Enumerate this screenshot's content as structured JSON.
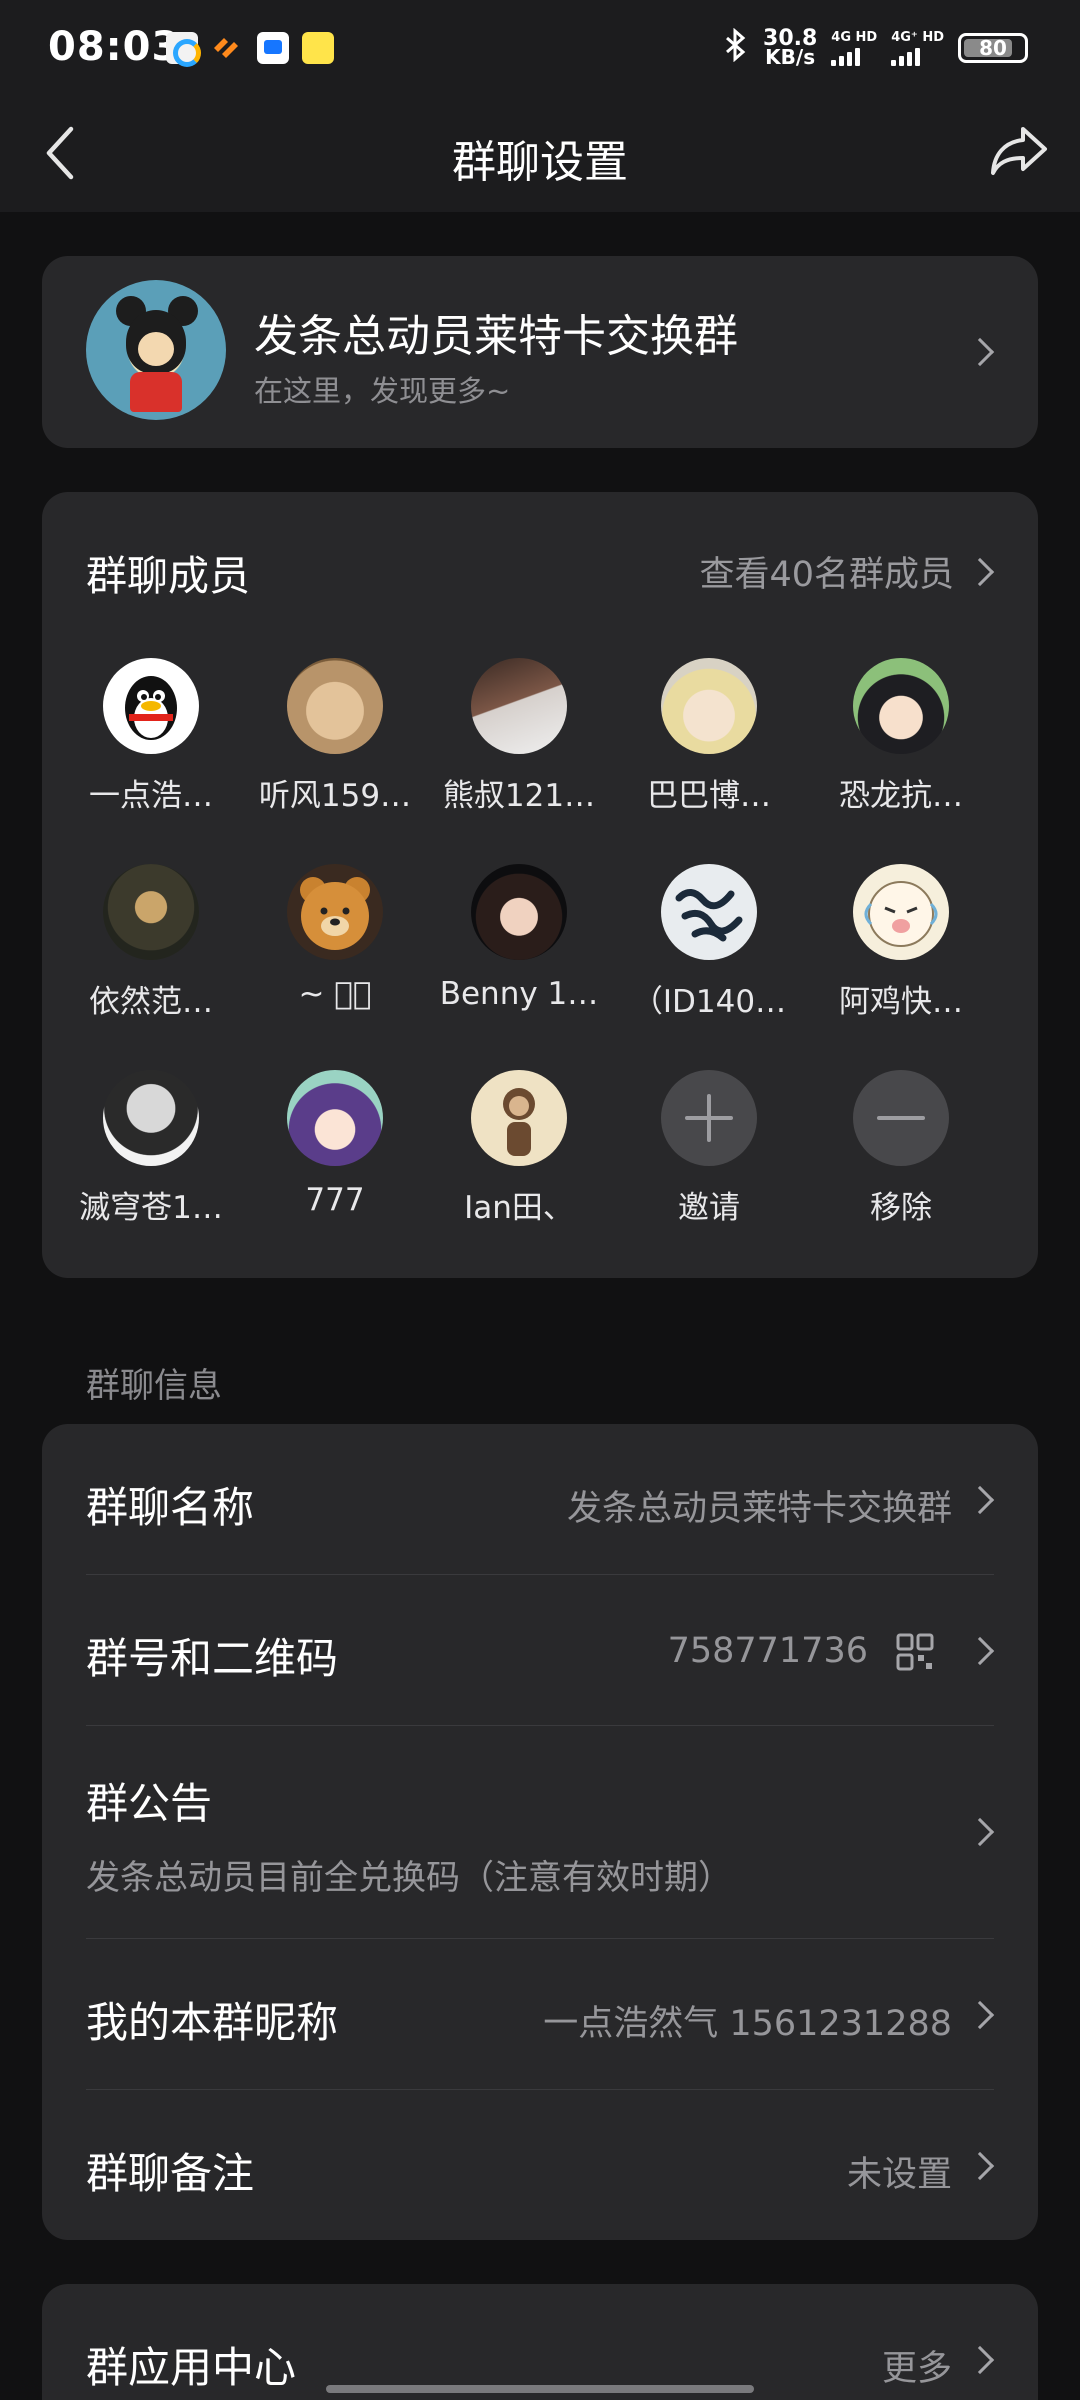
{
  "status_bar": {
    "time": "08:03",
    "speed_value": "30.8",
    "speed_unit": "KB/s",
    "sim1": "4G HD",
    "sim2": "4G⁺ HD",
    "battery": "80"
  },
  "header": {
    "title": "群聊设置"
  },
  "group": {
    "name": "发条总动员莱特卡交换群",
    "subtitle": "在这里，发现更多~"
  },
  "members": {
    "title": "群聊成员",
    "view_all": "查看40名群成员",
    "items": [
      {
        "name": "一点浩…",
        "avatar": "penguin-avatar"
      },
      {
        "name": "听风159…",
        "avatar": "dog-avatar"
      },
      {
        "name": "熊叔121…",
        "avatar": "man-avatar"
      },
      {
        "name": "巴巴博…",
        "avatar": "anime-avatar"
      },
      {
        "name": "恐龙抗…",
        "avatar": "anime-boy-avatar"
      },
      {
        "name": "依然范…",
        "avatar": "person-avatar"
      },
      {
        "name": "~ ෆ゙",
        "avatar": "teddy-bear-avatar"
      },
      {
        "name": "Benny 1…",
        "avatar": "person-avatar"
      },
      {
        "name": "（ID140…",
        "avatar": "calligraphy-avatar"
      },
      {
        "name": "阿鸡快…",
        "avatar": "cartoon-avatar"
      },
      {
        "name": "滅穹苍1…",
        "avatar": "person-avatar"
      },
      {
        "name": "777",
        "avatar": "anime-girl-avatar"
      },
      {
        "name": "Ian田、",
        "avatar": "figure-avatar"
      }
    ],
    "invite_label": "邀请",
    "remove_label": "移除"
  },
  "info": {
    "section_label": "群聊信息",
    "group_name_label": "群聊名称",
    "group_name_value": "发条总动员莱特卡交换群",
    "group_number_label": "群号和二维码",
    "group_number_value": "758771736",
    "announcement_label": "群公告",
    "announcement_value": "发条总动员目前全兑换码（注意有效时期）",
    "nickname_label": "我的本群昵称",
    "nickname_value": "一点浩然气 1561231288",
    "remark_label": "群聊备注",
    "remark_value": "未设置"
  },
  "apps": {
    "label": "群应用中心",
    "more": "更多"
  },
  "colors": {
    "background": "#111112",
    "card": "#28282a",
    "text_primary": "#ffffff",
    "text_secondary": "#96969a"
  }
}
